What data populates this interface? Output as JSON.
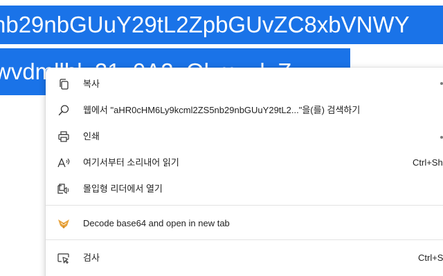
{
  "selected_text": {
    "line1": "nb29nbGUuY29tL2ZpbGUvZC8xbVNWY",
    "line2": "wvdmllbl_21_0A2_Ol_u__l_Z"
  },
  "context_menu": {
    "copy": {
      "label": "복사",
      "icon": "copy-icon"
    },
    "search_web": {
      "label": "웹에서 \"aHR0cHM6Ly9kcml2ZS5nb29nbGUuY29tL2...\"을(를) 검색하기",
      "icon": "search-icon"
    },
    "print": {
      "label": "인쇄",
      "icon": "print-icon"
    },
    "read_aloud": {
      "label": "여기서부터 소리내어 읽기",
      "shortcut": "Ctrl+Sh",
      "icon": "read-aloud-icon"
    },
    "immersive_reader": {
      "label": "몰입형 리더에서 열기",
      "icon": "immersive-reader-icon"
    },
    "decode_base64": {
      "label": "Decode base64 and open in new tab",
      "icon": "extension-icon"
    },
    "inspect": {
      "label": "검사",
      "shortcut": "Ctrl+S",
      "icon": "inspect-icon"
    }
  },
  "colors": {
    "selection": "#1a73e8",
    "menu_bg": "#ffffff",
    "separator": "#e3e3e3",
    "extension_icon": "#e8a33d"
  }
}
